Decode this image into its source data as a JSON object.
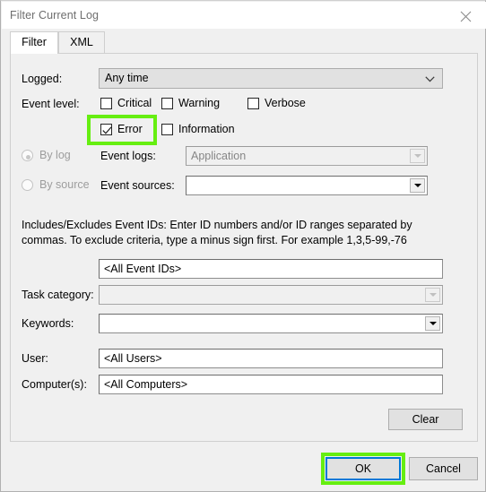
{
  "window": {
    "title": "Filter Current Log",
    "close_icon": "close-icon"
  },
  "tabs": [
    {
      "label": "Filter",
      "selected": true
    },
    {
      "label": "XML",
      "selected": false
    }
  ],
  "form": {
    "logged": {
      "label": "Logged:",
      "value": "Any time",
      "enabled": true
    },
    "event_level": {
      "label": "Event level:",
      "checkboxes": [
        {
          "label": "Critical",
          "checked": false,
          "highlighted": false
        },
        {
          "label": "Warning",
          "checked": false,
          "highlighted": false
        },
        {
          "label": "Verbose",
          "checked": false,
          "highlighted": false
        },
        {
          "label": "Error",
          "checked": true,
          "highlighted": true
        },
        {
          "label": "Information",
          "checked": false,
          "highlighted": false
        }
      ]
    },
    "source_mode": {
      "by_log": {
        "label": "By log",
        "selected": true,
        "enabled": false
      },
      "by_source": {
        "label": "By source",
        "selected": false,
        "enabled": false
      }
    },
    "event_logs": {
      "label": "Event logs:",
      "value": "Application",
      "enabled": false
    },
    "event_sources": {
      "label": "Event sources:",
      "value": "",
      "enabled": true
    },
    "event_ids": {
      "hint": "Includes/Excludes Event IDs: Enter ID numbers and/or ID ranges separated by commas. To exclude criteria, type a minus sign first. For example 1,3,5-99,-76",
      "value": "<All Event IDs>"
    },
    "task_category": {
      "label": "Task category:",
      "value": "",
      "enabled": false
    },
    "keywords": {
      "label": "Keywords:",
      "value": "",
      "enabled": true
    },
    "user": {
      "label": "User:",
      "value": "<All Users>"
    },
    "computers": {
      "label": "Computer(s):",
      "value": "<All Computers>"
    },
    "clear_button": "Clear"
  },
  "footer": {
    "ok": "OK",
    "cancel": "Cancel"
  },
  "colors": {
    "highlight": "#66ee11",
    "focus_border": "#0078d7",
    "dialog_bg": "#f0f0f0",
    "titlebar_bg": "#ffffff",
    "disabled_text": "#9d9d9d"
  }
}
